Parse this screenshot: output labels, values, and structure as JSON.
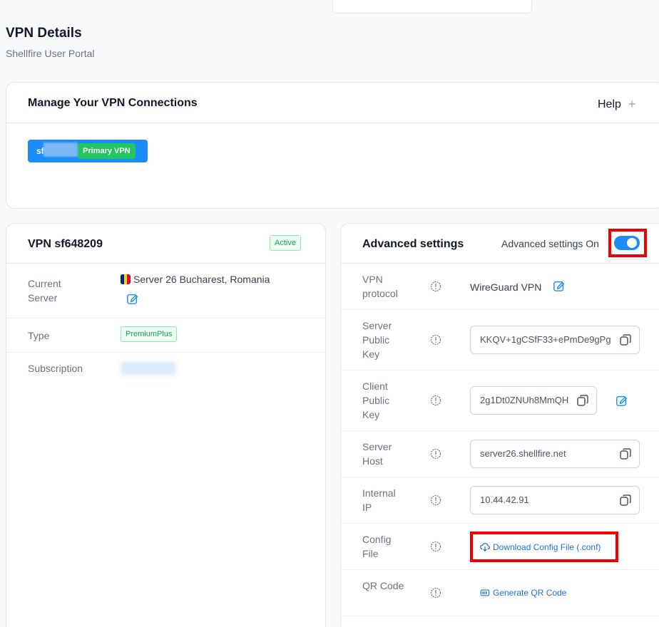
{
  "header": {
    "title": "VPN Details",
    "subtitle": "Shellfire User Portal"
  },
  "manage": {
    "title": "Manage Your VPN Connections",
    "help_label": "Help",
    "chip_prefix": "sf",
    "chip_badge": "Primary VPN"
  },
  "vpn": {
    "title": "VPN sf648209",
    "status": "Active",
    "rows": {
      "current_server_label": "Current Server",
      "current_server_value": "Server 26 Bucharest, Romania",
      "type_label": "Type",
      "type_value": "PremiumPlus",
      "subscription_label": "Subscription"
    },
    "flag_colors": [
      "#002b7f",
      "#fcd116",
      "#ce1126"
    ]
  },
  "advanced": {
    "title": "Advanced settings",
    "toggle_label": "Advanced settings On",
    "rows": [
      {
        "label": "VPN protocol",
        "value": "WireGuard VPN"
      },
      {
        "label": "Server Public Key",
        "value": "KKQV+1gCSfF33+ePmDe9gPg"
      },
      {
        "label": "Client Public Key",
        "value": "2g1Dt0ZNUh8MmQH"
      },
      {
        "label": "Server Host",
        "value": "server26.shellfire.net"
      },
      {
        "label": "Internal IP",
        "value": "10.44.42.91"
      },
      {
        "label": "Config File",
        "value": "Download Config File (.conf)"
      },
      {
        "label": "QR Code",
        "value": "Generate QR Code"
      }
    ]
  },
  "colors": {
    "accent": "#1d8cf8",
    "success": "#22c55e",
    "highlight": "#ee0000"
  }
}
